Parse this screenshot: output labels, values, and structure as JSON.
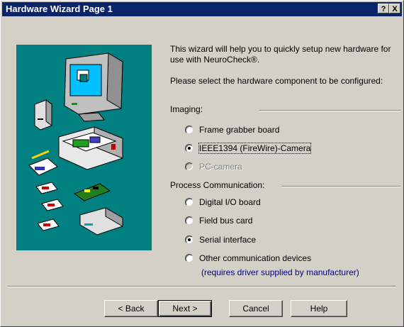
{
  "window": {
    "title": "Hardware Wizard Page 1",
    "help_button": "?",
    "close_button": "X"
  },
  "intro": {
    "line1": "This wizard will help you to quickly setup new hardware for use with NeuroCheck®.",
    "line2": "Please select the hardware component to be configured:"
  },
  "imaging": {
    "label": "Imaging:",
    "options": [
      {
        "label": "Frame grabber board",
        "selected": false,
        "disabled": false
      },
      {
        "label": "IEEE1394 (FireWire)-Camera",
        "selected": true,
        "disabled": false
      },
      {
        "label": "PC-camera",
        "selected": false,
        "disabled": true
      }
    ]
  },
  "process": {
    "label": "Process Communication:",
    "options": [
      {
        "label": "Digital I/O board",
        "selected": false
      },
      {
        "label": "Field bus card",
        "selected": false
      },
      {
        "label": "Serial interface",
        "selected": true
      },
      {
        "label": "Other communication devices",
        "selected": false
      }
    ],
    "note": "(requires driver supplied by manufacturer)"
  },
  "buttons": {
    "back": "< Back",
    "next": "Next >",
    "cancel": "Cancel",
    "help": "Help"
  },
  "colors": {
    "titlebar": "#0a246a",
    "illustration_bg": "#008080",
    "dialog_bg": "#d4d0c8",
    "note_text": "#000080"
  }
}
